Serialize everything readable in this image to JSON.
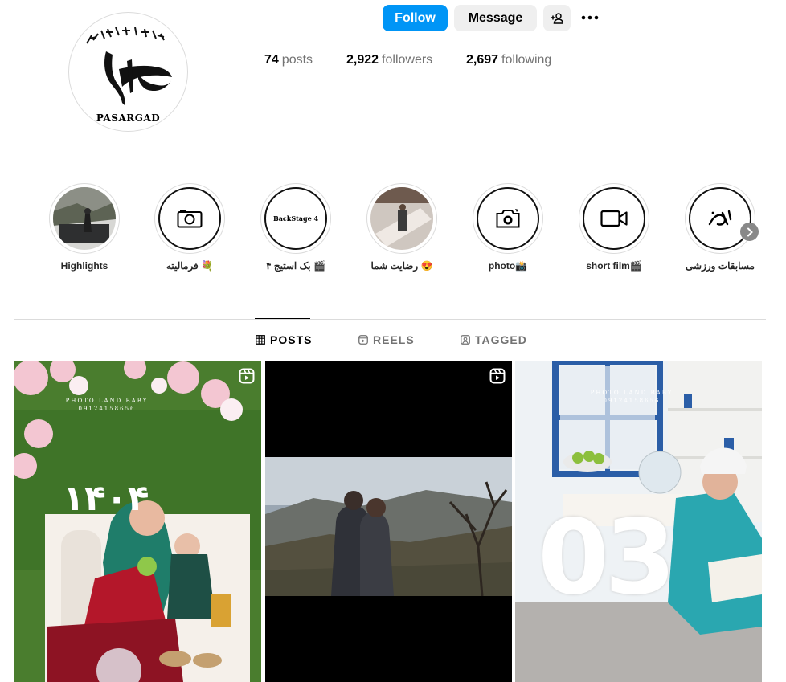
{
  "profile": {
    "avatar_text": "PASARGAD"
  },
  "actions": {
    "follow_label": "Follow",
    "message_label": "Message"
  },
  "stats": {
    "posts_count": "74",
    "posts_label": "posts",
    "followers_count": "2,922",
    "followers_label": "followers",
    "following_count": "2,697",
    "following_label": "following"
  },
  "highlights": [
    {
      "label": "Highlights",
      "icon": "photo-thumbnail"
    },
    {
      "label": "فرمالیته 💐",
      "icon": "camera-icon"
    },
    {
      "label": "بک استیج ۴ 🎬",
      "icon": "backstage-text"
    },
    {
      "label": "رضایت شما 😍",
      "icon": "photo-thumbnail"
    },
    {
      "label": "photo📸",
      "icon": "camera-flash-icon"
    },
    {
      "label": "short film🎬",
      "icon": "video-camera-icon"
    },
    {
      "label": "مسابقات ورزشی",
      "icon": "calligraphy-logo"
    }
  ],
  "highlight_inner_text": "BackStage 4",
  "tabs": [
    {
      "label": "POSTS",
      "active": true
    },
    {
      "label": "REELS",
      "active": false
    },
    {
      "label": "TAGGED",
      "active": false
    }
  ],
  "posts": [
    {
      "type": "reel",
      "watermark_1": "PHOTO LAND BABY",
      "watermark_2": "09124158656",
      "overlay_number": "۱۴۰۴"
    },
    {
      "type": "reel"
    },
    {
      "type": "photo",
      "watermark_1": "PHOTO LAND BABY",
      "watermark_2": "09124158656",
      "overlay_number": "03"
    }
  ],
  "colors": {
    "follow_blue": "#0095f6",
    "secondary_button": "#efefef",
    "muted_text": "#737373",
    "divider": "#dbdbdb"
  }
}
